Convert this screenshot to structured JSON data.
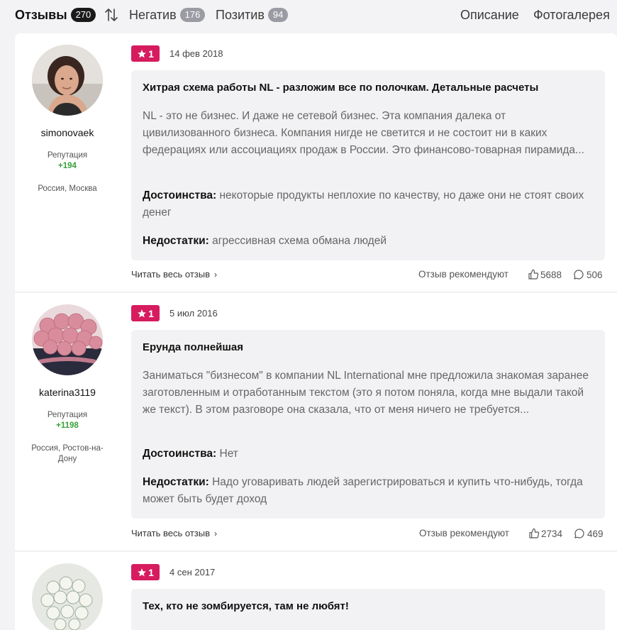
{
  "tabs": {
    "reviews_label": "Отзывы",
    "reviews_count": "270",
    "negative_label": "Негатив",
    "negative_count": "176",
    "positive_label": "Позитив",
    "positive_count": "94",
    "description_label": "Описание",
    "gallery_label": "Фотогалерея"
  },
  "labels": {
    "reputation": "Репутация",
    "pros": "Достоинства:",
    "cons": "Недостатки:",
    "read_more": "Читать весь отзыв",
    "recommend": "Отзыв рекомендуют"
  },
  "reviews": [
    {
      "author": "simonovaek",
      "reputation": "+194",
      "location": "Россия, Москва",
      "rating": "1",
      "date": "14 фев 2018",
      "title": "Хитрая схема работы NL - разложим все по полочкам. Детальные расчеты",
      "text": "NL - это не бизнес. И даже не сетевой бизнес. Эта компания далека от цивилизованного бизнеса. Компания нигде не светится и не состоит ни в каких федерациях или ассоциациях продаж в России. Это финансово-товарная пирамида...",
      "pros": "некоторые продукты неплохие по качеству, но даже они не стоят своих денег",
      "cons": "агрессивная схема обмана людей",
      "likes": "5688",
      "comments": "506"
    },
    {
      "author": "katerina3119",
      "reputation": "+1198",
      "location": "Россия, Ростов-на-Дону",
      "rating": "1",
      "date": "5 июл 2016",
      "title": "Ерунда полнейшая",
      "text": "Заниматься \"бизнесом\" в компании NL International мне предложила знакомая заранее заготовленным и отработанным текстом (это я потом поняла, когда мне выдали такой же текст). В этом разговоре она сказала, что от меня ничего не требуется...",
      "pros": "Нет",
      "cons": "Надо уговаривать людей зарегистрироваться и купить что-нибудь, тогда может быть будет доход",
      "likes": "2734",
      "comments": "469"
    },
    {
      "rating": "1",
      "date": "4 сен 2017",
      "title": "Тех, кто не зомбируется, там не любят!"
    }
  ],
  "colors": {
    "rating_bg": "#d61c5e",
    "reputation": "#3aa13a",
    "active_badge": "#1a1a1a",
    "inactive_badge": "#9b9ba3"
  },
  "icons": [
    "sort-icon",
    "star-icon",
    "chevron-right-icon",
    "thumbs-up-icon",
    "comment-icon"
  ]
}
